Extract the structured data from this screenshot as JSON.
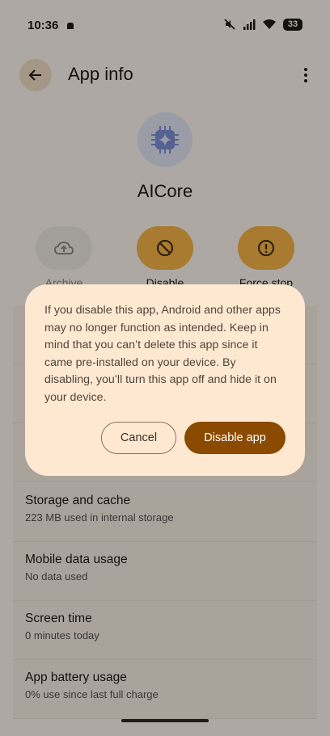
{
  "status_bar": {
    "time": "10:36",
    "icons": [
      "notification-icon",
      "mute-icon",
      "signal-icon",
      "wifi-icon"
    ],
    "battery": "33"
  },
  "app_bar": {
    "title": "App info",
    "back_icon": "arrow-back-icon",
    "more_icon": "more-vert-icon"
  },
  "app": {
    "name": "AICore",
    "icon": "chip-sparkle-icon"
  },
  "actions": [
    {
      "label": "Archive",
      "icon": "cloud-upload-icon",
      "enabled": false
    },
    {
      "label": "Disable",
      "icon": "block-icon",
      "enabled": true
    },
    {
      "label": "Force stop",
      "icon": "alert-icon",
      "enabled": true
    }
  ],
  "list_items": [
    {
      "title": "Storage and cache",
      "subtitle": "223 MB used in internal storage"
    },
    {
      "title": "Mobile data usage",
      "subtitle": "No data used"
    },
    {
      "title": "Screen time",
      "subtitle": "0 minutes today"
    },
    {
      "title": "App battery usage",
      "subtitle": "0% use since last full charge"
    }
  ],
  "dialog": {
    "message": "If you disable this app, Android and other apps may no longer function as intended. Keep in mind that you can’t delete this app since it came pre-installed on your device. By disabling, you’ll turn this app off and hide it on your device.",
    "cancel_label": "Cancel",
    "confirm_label": "Disable app"
  },
  "colors": {
    "accent": "#8a4a00",
    "tonal": "#f8b548",
    "dialog_surface": "#ffe8d2",
    "background": "#fff8f1"
  }
}
